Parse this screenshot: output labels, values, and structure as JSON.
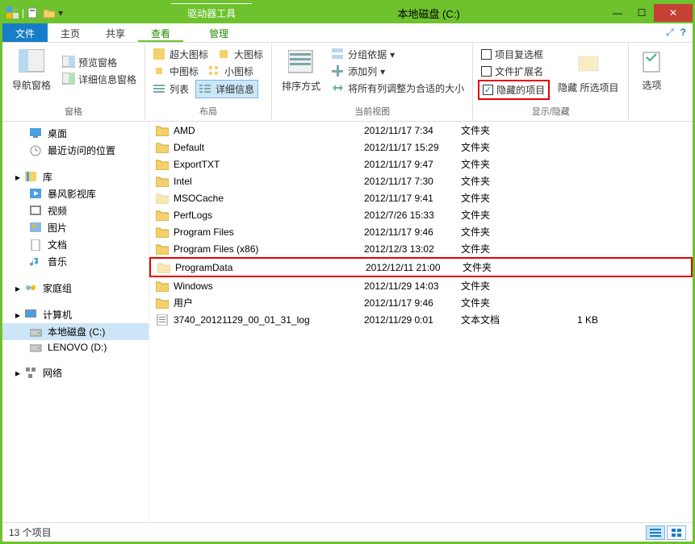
{
  "titlebar": {
    "contextual": "驱动器工具",
    "title": "本地磁盘 (C:)"
  },
  "tabs": [
    "文件",
    "主页",
    "共享",
    "查看",
    "管理"
  ],
  "ribbon": {
    "panes": {
      "nav": "导航窗格",
      "preview": "预览窗格",
      "details": "详细信息窗格",
      "label": "窗格"
    },
    "layout": [
      "超大图标",
      "大图标",
      "中图标",
      "小图标",
      "列表",
      "详细信息"
    ],
    "layout_label": "布局",
    "current": {
      "sort": "排序方式",
      "group": "分组依据",
      "addcol": "添加列",
      "sizecol": "将所有列调整为合适的大小",
      "label": "当前视图"
    },
    "showhide": {
      "checkboxes": "项目复选框",
      "extensions": "文件扩展名",
      "hidden": "隐藏的项目",
      "hide": "隐藏\n所选项目",
      "label": "显示/隐藏"
    },
    "options": "选项"
  },
  "nav": {
    "fav": [
      "桌面",
      "最近访问的位置"
    ],
    "lib": {
      "label": "库",
      "items": [
        "暴风影视库",
        "视频",
        "图片",
        "文档",
        "音乐"
      ]
    },
    "homegroup": "家庭组",
    "computer": {
      "label": "计算机",
      "items": [
        "本地磁盘 (C:)",
        "LENOVO (D:)"
      ]
    },
    "network": "网络"
  },
  "files": [
    {
      "name": "AMD",
      "date": "2012/11/17 7:34",
      "type": "文件夹",
      "size": "",
      "icon": "folder"
    },
    {
      "name": "Default",
      "date": "2012/11/17 15:29",
      "type": "文件夹",
      "size": "",
      "icon": "folder"
    },
    {
      "name": "ExportTXT",
      "date": "2012/11/17 9:47",
      "type": "文件夹",
      "size": "",
      "icon": "folder"
    },
    {
      "name": "Intel",
      "date": "2012/11/17 7:30",
      "type": "文件夹",
      "size": "",
      "icon": "folder"
    },
    {
      "name": "MSOCache",
      "date": "2012/11/17 9:41",
      "type": "文件夹",
      "size": "",
      "icon": "folder-hidden"
    },
    {
      "name": "PerfLogs",
      "date": "2012/7/26 15:33",
      "type": "文件夹",
      "size": "",
      "icon": "folder"
    },
    {
      "name": "Program Files",
      "date": "2012/11/17 9:46",
      "type": "文件夹",
      "size": "",
      "icon": "folder"
    },
    {
      "name": "Program Files (x86)",
      "date": "2012/12/3 13:02",
      "type": "文件夹",
      "size": "",
      "icon": "folder"
    },
    {
      "name": "ProgramData",
      "date": "2012/12/11 21:00",
      "type": "文件夹",
      "size": "",
      "icon": "folder-hidden",
      "highlight": true
    },
    {
      "name": "Windows",
      "date": "2012/11/29 14:03",
      "type": "文件夹",
      "size": "",
      "icon": "folder"
    },
    {
      "name": "用户",
      "date": "2012/11/17 9:46",
      "type": "文件夹",
      "size": "",
      "icon": "folder"
    },
    {
      "name": "3740_20121129_00_01_31_log",
      "date": "2012/11/29 0:01",
      "type": "文本文档",
      "size": "1 KB",
      "icon": "file"
    }
  ],
  "status": {
    "text": "13 个项目"
  }
}
